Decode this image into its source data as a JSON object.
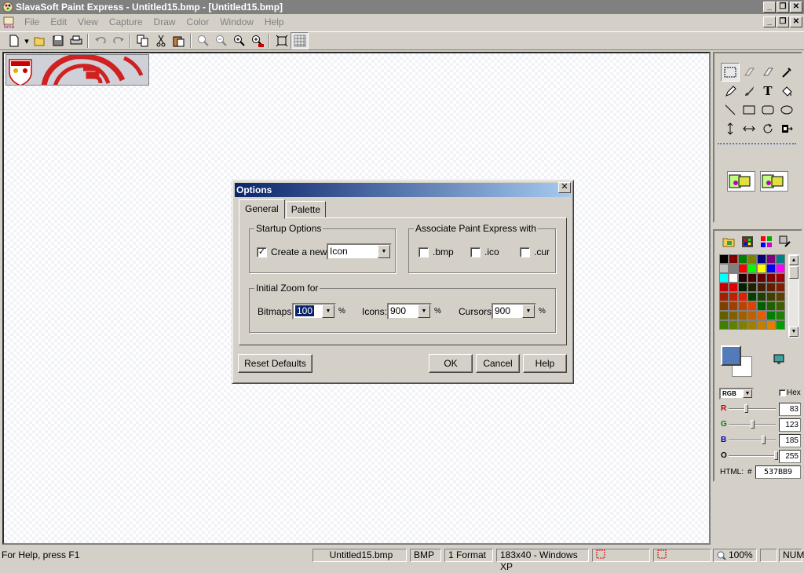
{
  "window": {
    "title": "SlavaSoft Paint Express - Untitled15.bmp - [Untitled15.bmp]"
  },
  "menu": [
    "File",
    "Edit",
    "View",
    "Capture",
    "Draw",
    "Color",
    "Window",
    "Help"
  ],
  "toolbar_icons": [
    "new-icon",
    "open-icon",
    "save-icon",
    "print-icon",
    "undo-icon",
    "redo-icon",
    "copy-icon",
    "cut-icon",
    "paste-icon",
    "zoom-out-icon",
    "zoom-out-small-icon",
    "zoom-in-icon",
    "zoom-actual-icon",
    "fit-icon",
    "grid-icon"
  ],
  "dialog": {
    "title": "Options",
    "close": "✕",
    "tabs": [
      "General",
      "Palette"
    ],
    "startup": {
      "group_label": "Startup Options",
      "create_new_label": "Create a new",
      "create_new_checked": "✓",
      "create_new_value": "Icon"
    },
    "associate": {
      "group_label": "Associate Paint Express with",
      "items": [
        ".bmp",
        ".ico",
        ".cur"
      ]
    },
    "zoom": {
      "group_label": "Initial Zoom for",
      "bitmaps_label": "Bitmaps:",
      "bitmaps_value": "100",
      "icons_label": "Icons:",
      "icons_value": "900",
      "cursors_label": "Cursors:",
      "cursors_value": "900",
      "percent": "%"
    },
    "buttons": {
      "reset": "Reset Defaults",
      "ok": "OK",
      "cancel": "Cancel",
      "help": "Help"
    }
  },
  "color_panel": {
    "mode": "RGB",
    "hex_label": "Hex",
    "r_label": "R",
    "r_value": "83",
    "g_label": "G",
    "g_value": "123",
    "b_label": "B",
    "b_value": "185",
    "o_label": "O",
    "o_value": "255",
    "html_label": "HTML:",
    "hash": "#",
    "html_value": "537BB9",
    "foreground": "#537bb9",
    "background": "#ffffff"
  },
  "status": {
    "help": "For Help, press F1",
    "file": "Untitled15.bmp",
    "format": "BMP",
    "count": "1 Format",
    "size": "183x40 - Windows XP",
    "zoom": "100%",
    "num": "NUM"
  }
}
